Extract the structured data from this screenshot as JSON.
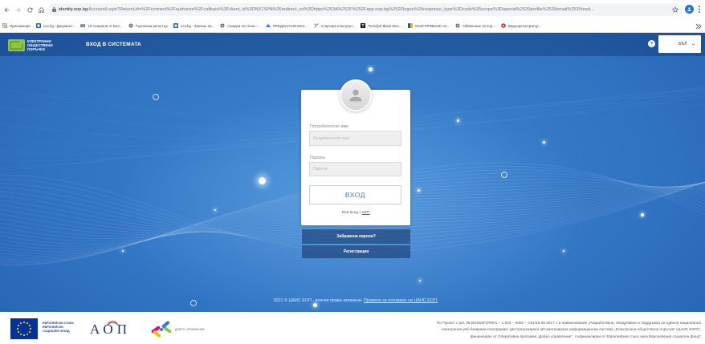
{
  "browser": {
    "url_host": "identity.eop.bg",
    "url_path": "/Account/Login?ReturnUrl=%2Fconnect%2Fauthorize%2Fcallback%3Fclient_id%3DNX1SPA%26redirect_uri%3Dhttps%253A%252F%252Fapp.eop.bg%252Flogon%26response_type%3Dcode%26scope%3Dopenid%2520profile%2520email%2520read...",
    "bookmarks": [
      {
        "label": "Приложения",
        "icon": "apps-grid-icon"
      },
      {
        "label": "Lex.bg - Документ...",
        "icon": "lex-bg-favicon-icon"
      },
      {
        "label": "19 генерали от Бал...",
        "icon": "news-favicon-icon"
      },
      {
        "label": "Търговски регистър",
        "icon": "globe-icon"
      },
      {
        "label": "Lex.bg - Закони, пр...",
        "icon": "lex-bg-favicon-icon"
      },
      {
        "label": "стикери за стена -...",
        "icon": "globe-icon"
      },
      {
        "label": "ПРЕДЛАГАНИ МАС...",
        "icon": "site-favicon-icon"
      },
      {
        "label": "Стартира електрон...",
        "icon": "site-favicon-icon"
      },
      {
        "label": "Trendyol Black Men...",
        "icon": "trendyol-favicon-icon"
      },
      {
        "label": "ОСИГУРЯВАНЕ НА...",
        "icon": "site-favicon-icon"
      },
      {
        "label": "Обявление за пор...",
        "icon": "globe-icon"
      },
      {
        "label": "Видеорегистратор...",
        "icon": "red-circle-favicon-icon"
      }
    ]
  },
  "header": {
    "logo_lines": [
      "ЕЛЕКТРОННИ",
      "ОБЩЕСТВЕНИ",
      "ПОРЪЧКИ"
    ],
    "title": "ВХОД В СИСТЕМАТА",
    "language": "БЪЛ"
  },
  "login": {
    "username_label": "Потребителско име",
    "username_placeholder": "Потребителско име",
    "password_label": "Парола",
    "password_placeholder": "Парола",
    "submit_label": "ВХОД",
    "alt_login_prefix": "Или вход с",
    "alt_login_link": "КЕП",
    "forgot_password_label": "Забравена парола?",
    "register_label": "Регистрация"
  },
  "footer": {
    "copyright": "2021 © ЦАИС ЕОП - всички права запазени.",
    "terms_link": "Правила за ползване на ЦАИС ЕОП.",
    "eu_logo_lines": [
      "ЕВРОПЕЙСКИ СЪЮЗ",
      "ЕВРОПЕЙСКИ",
      "СОЦИАЛЕН ФОНД"
    ],
    "aop_logo": "АОП",
    "good_governance_logo": "ДОБРО УПРАВЛЕНИЕ",
    "funding_notice_lines": [
      "По Проект с рег. № BG05SFOP001 – 1.003 – 0002 – C01/15.06.2017 г. и наименование „Разработване, внедряване и поддръжка на единна национална",
      "електронна уеб-базирана платформа: Централизирана автоматизирана информационна система „Електронни обществени поръчки“ (ЦАИС ЕОП)“,",
      "финансиран от Оперативна програма „Добро управление“, съфинансиран от Европейския съюз чрез Европейския социален фонд“"
    ]
  },
  "colors": {
    "accent": "#2f6fbf",
    "header_bg": "#1d4f93",
    "eop_green": "#8dc63f",
    "eu_blue": "#003399",
    "eu_yellow": "#ffcc00"
  }
}
